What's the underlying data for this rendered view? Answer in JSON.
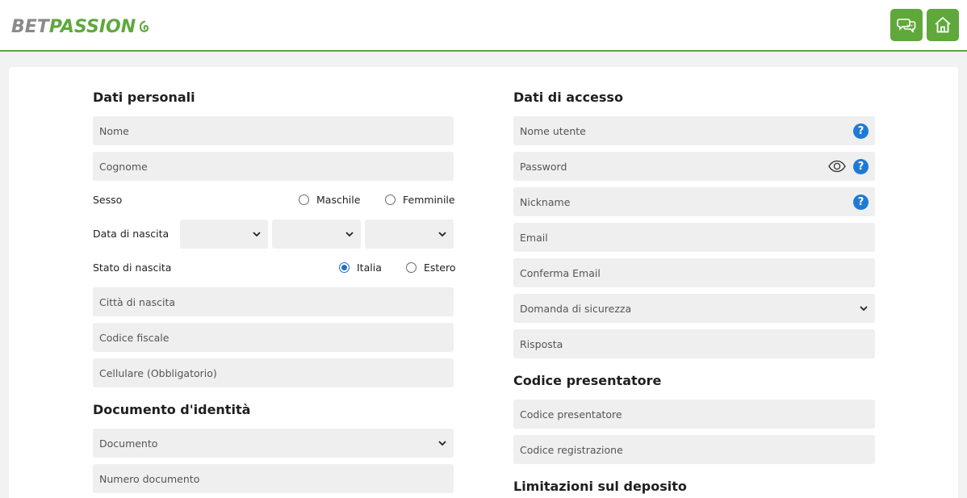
{
  "header": {
    "logo_bet": "BET",
    "logo_passion": "PASSION",
    "chat_icon": "chat-bubbles-icon",
    "home_icon": "home-icon",
    "accent": "#5fa83c"
  },
  "personal": {
    "title": "Dati personali",
    "nome": "Nome",
    "cognome": "Cognome",
    "sesso_label": "Sesso",
    "maschile": "Maschile",
    "femminile": "Femminile",
    "data_nascita_label": "Data di nascita",
    "stato_nascita_label": "Stato di nascita",
    "italia": "Italia",
    "estero": "Estero",
    "stato_selected": "Italia",
    "citta": "Città di nascita",
    "codice_fiscale": "Codice fiscale",
    "cellulare": "Cellulare (Obbligatorio)"
  },
  "documento": {
    "title": "Documento d'identità",
    "tipo": "Documento",
    "numero": "Numero documento"
  },
  "accesso": {
    "title": "Dati di accesso",
    "nome_utente": "Nome utente",
    "password": "Password",
    "nickname": "Nickname",
    "email": "Email",
    "conferma_email": "Conferma Email",
    "domanda": "Domanda di sicurezza",
    "risposta": "Risposta"
  },
  "presentatore": {
    "title": "Codice presentatore",
    "codice": "Codice presentatore",
    "registrazione": "Codice registrazione"
  },
  "limitazioni": {
    "title": "Limitazioni sul deposito"
  },
  "help_glyph": "?"
}
